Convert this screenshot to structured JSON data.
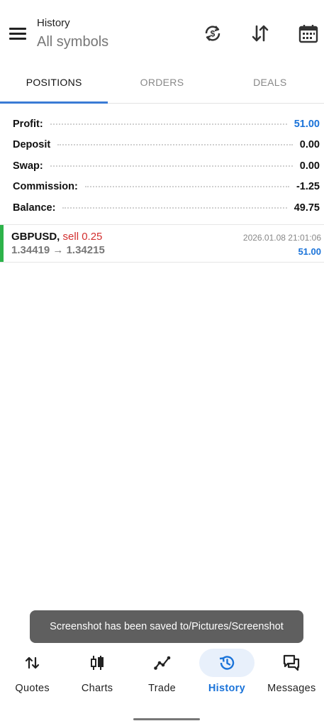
{
  "header": {
    "title": "History",
    "subtitle": "All symbols"
  },
  "tabs": [
    {
      "label": "POSITIONS",
      "active": true
    },
    {
      "label": "ORDERS",
      "active": false
    },
    {
      "label": "DEALS",
      "active": false
    }
  ],
  "summary": {
    "profit": {
      "label": "Profit:",
      "value": "51.00"
    },
    "deposit": {
      "label": "Deposit",
      "value": "0.00"
    },
    "swap": {
      "label": "Swap:",
      "value": "0.00"
    },
    "commission": {
      "label": "Commission:",
      "value": "-1.25"
    },
    "balance": {
      "label": "Balance:",
      "value": "49.75"
    }
  },
  "deals": [
    {
      "symbol": "GBPUSD,",
      "side": "sell 0.25",
      "open_price": "1.34419",
      "arrow": "→",
      "close_price": "1.34215",
      "time": "2026.01.08 21:01:06",
      "profit": "51.00"
    }
  ],
  "toast": {
    "text": "Screenshot has been saved to/Pictures/Screenshot"
  },
  "nav": [
    {
      "label": "Quotes",
      "icon": "quotes-icon",
      "active": false
    },
    {
      "label": "Charts",
      "icon": "charts-icon",
      "active": false
    },
    {
      "label": "Trade",
      "icon": "trade-icon",
      "active": false
    },
    {
      "label": "History",
      "icon": "history-icon",
      "active": true
    },
    {
      "label": "Messages",
      "icon": "messages-icon",
      "active": false
    }
  ],
  "colors": {
    "accent": "#1a73d9",
    "sell": "#d32f2f",
    "profit_bar": "#2db34a",
    "tab_indicator": "#3a7bd5"
  }
}
